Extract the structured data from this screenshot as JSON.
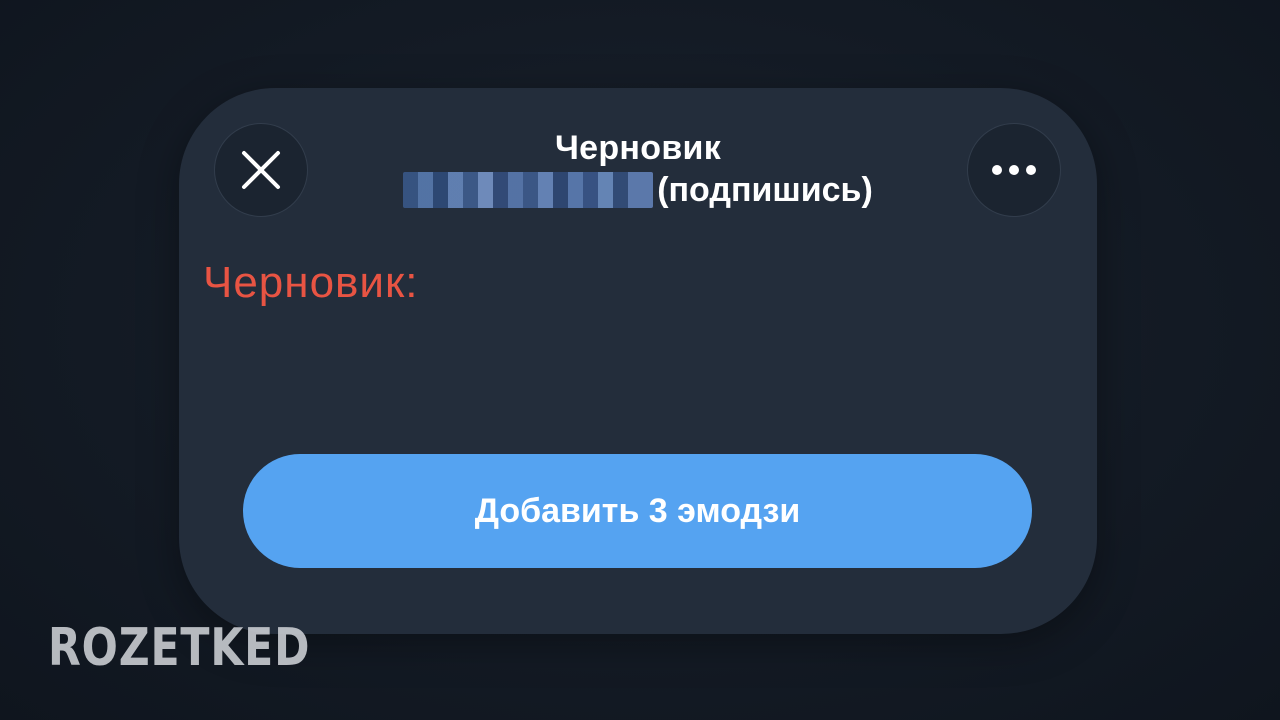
{
  "dialog": {
    "title": "Черновик",
    "subtitle_suffix": "(подпишись)",
    "draft_label": "Черновик:",
    "add_button_label": "Добавить 3 эмодзи",
    "close_icon": "close-icon",
    "more_icon": "more-horizontal-icon"
  },
  "watermark": {
    "logo_text": "ROZETKED"
  },
  "colors": {
    "background": "#121923",
    "sheet": "#232d3b",
    "accent": "#55a3f1",
    "draft_text": "#e85443"
  }
}
